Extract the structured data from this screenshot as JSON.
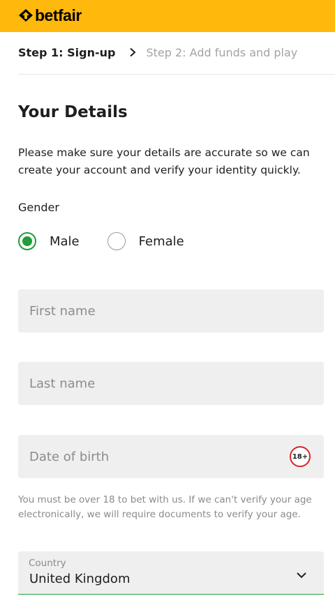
{
  "header": {
    "brand": "betfair",
    "brand_color": "#ffb80c"
  },
  "steps": {
    "active": "Step 1: Sign-up",
    "next": "Step 2: Add funds and play"
  },
  "form": {
    "title": "Your Details",
    "intro": "Please make sure your details are accurate so we can create your account and verify your identity quickly.",
    "gender": {
      "label": "Gender",
      "options": [
        "Male",
        "Female"
      ],
      "selected": "Male"
    },
    "first_name": {
      "placeholder": "First name",
      "value": ""
    },
    "last_name": {
      "placeholder": "Last name",
      "value": ""
    },
    "date_of_birth": {
      "placeholder": "Date of birth",
      "value": "",
      "age_badge": "18+"
    },
    "age_note": "You must be over 18 to bet with us. If we can't verify your age electronically, we will require documents to verify your age.",
    "country": {
      "label": "Country",
      "value": "United Kingdom"
    }
  },
  "icons": {
    "logo": "betfair-arrow-icon",
    "step_separator": "chevron-right-icon",
    "country_dropdown": "chevron-down-icon"
  },
  "colors": {
    "accent_green": "#1f9e3a",
    "age_badge_red": "#d8232a"
  }
}
